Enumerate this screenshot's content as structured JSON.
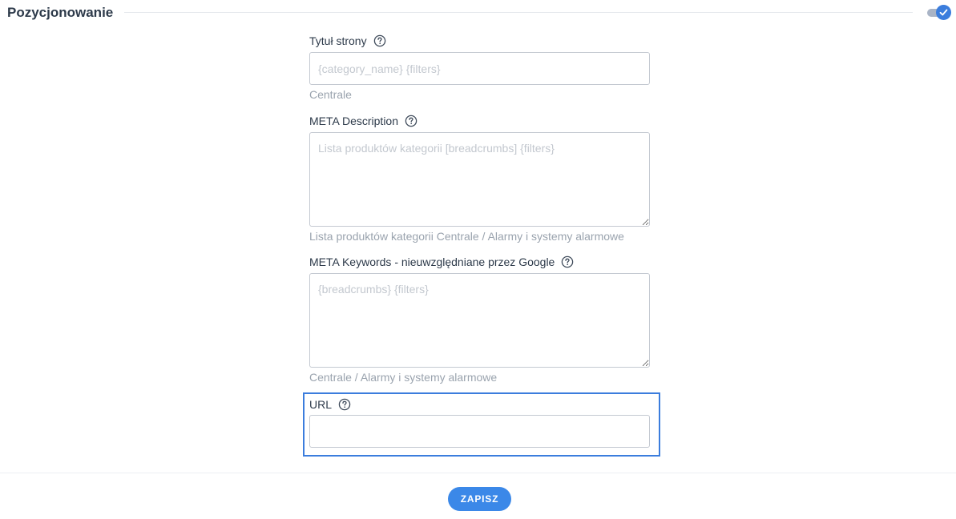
{
  "section": {
    "title": "Pozycjonowanie",
    "toggle_icon": "check-icon",
    "accent_color": "#3b7ddd"
  },
  "fields": {
    "page_title": {
      "label": "Tytuł strony",
      "placeholder": "{category_name} {filters}",
      "value": "",
      "hint": "Centrale"
    },
    "meta_description": {
      "label": "META Description",
      "placeholder": "Lista produktów kategorii [breadcrumbs] {filters}",
      "value": "",
      "hint": "Lista produktów kategorii Centrale / Alarmy i systemy alarmowe"
    },
    "meta_keywords": {
      "label": "META Keywords - nieuwzględniane przez Google",
      "placeholder": "{breadcrumbs} {filters}",
      "value": "",
      "hint": "Centrale / Alarmy i systemy alarmowe"
    },
    "url": {
      "label": "URL",
      "placeholder": "",
      "value": ""
    }
  },
  "help_icon": "question-circle-icon",
  "footer": {
    "save_label": "ZAPISZ"
  }
}
